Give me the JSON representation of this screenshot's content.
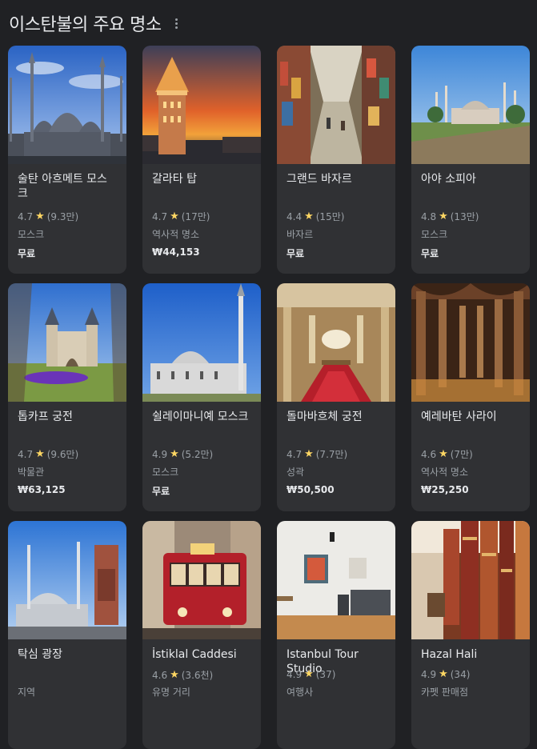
{
  "header": {
    "title": "이스탄불의 주요 명소"
  },
  "places": [
    {
      "name": "술탄 아흐메트 모스크",
      "score": "4.7",
      "reviews": "(9.3만)",
      "category": "모스크",
      "price": "무료",
      "image": "blue-mosque-photo"
    },
    {
      "name": "갈라타 탑",
      "score": "4.7",
      "reviews": "(17만)",
      "category": "역사적 명소",
      "price": "₩44,153",
      "image": "galata-tower-photo"
    },
    {
      "name": "그랜드 바자르",
      "score": "4.4",
      "reviews": "(15만)",
      "category": "바자르",
      "price": "무료",
      "image": "grand-bazaar-photo"
    },
    {
      "name": "아야 소피아",
      "score": "4.8",
      "reviews": "(13만)",
      "category": "모스크",
      "price": "무료",
      "image": "hagia-sophia-photo"
    },
    {
      "name": "톱카프 궁전",
      "score": "4.7",
      "reviews": "(9.6만)",
      "category": "박물관",
      "price": "₩63,125",
      "image": "topkapi-palace-photo"
    },
    {
      "name": "쉴레이마니예 모스크",
      "score": "4.9",
      "reviews": "(5.2만)",
      "category": "모스크",
      "price": "무료",
      "image": "suleymaniye-mosque-photo"
    },
    {
      "name": "돌마바흐체 궁전",
      "score": "4.7",
      "reviews": "(7.7만)",
      "category": "성곽",
      "price": "₩50,500",
      "image": "dolmabahce-palace-photo"
    },
    {
      "name": "예레바탄 사라이",
      "score": "4.6",
      "reviews": "(7만)",
      "category": "역사적 명소",
      "price": "₩25,250",
      "image": "basilica-cistern-photo"
    },
    {
      "name": "탁심 광장",
      "score": "",
      "reviews": "",
      "category": "지역",
      "price": "",
      "image": "taksim-square-photo"
    },
    {
      "name": "İstiklal Caddesi",
      "score": "4.6",
      "reviews": "(3.6천)",
      "category": "유명 거리",
      "price": "",
      "image": "istiklal-tram-photo"
    },
    {
      "name": "Istanbul Tour Studio",
      "score": "4.9",
      "reviews": "(37)",
      "category": "여행사",
      "price": "",
      "image": "tour-studio-photo"
    },
    {
      "name": "Hazal Hali",
      "score": "4.9",
      "reviews": "(34)",
      "category": "카펫 판매점",
      "price": "",
      "image": "carpet-shop-photo"
    }
  ],
  "colors": {
    "background": "#202124",
    "card": "#303134",
    "star": "#fdd663",
    "muted": "#9aa0a6"
  },
  "icons": {
    "more": "more-vert-icon",
    "star": "star-icon"
  }
}
